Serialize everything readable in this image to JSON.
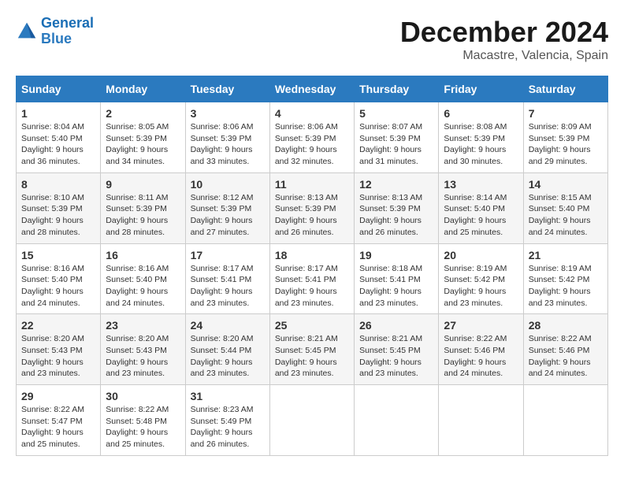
{
  "logo": {
    "line1": "General",
    "line2": "Blue"
  },
  "title": "December 2024",
  "location": "Macastre, Valencia, Spain",
  "days_of_week": [
    "Sunday",
    "Monday",
    "Tuesday",
    "Wednesday",
    "Thursday",
    "Friday",
    "Saturday"
  ],
  "weeks": [
    [
      {
        "day": "1",
        "sunrise": "8:04 AM",
        "sunset": "5:40 PM",
        "daylight": "9 hours and 36 minutes."
      },
      {
        "day": "2",
        "sunrise": "8:05 AM",
        "sunset": "5:39 PM",
        "daylight": "9 hours and 34 minutes."
      },
      {
        "day": "3",
        "sunrise": "8:06 AM",
        "sunset": "5:39 PM",
        "daylight": "9 hours and 33 minutes."
      },
      {
        "day": "4",
        "sunrise": "8:06 AM",
        "sunset": "5:39 PM",
        "daylight": "9 hours and 32 minutes."
      },
      {
        "day": "5",
        "sunrise": "8:07 AM",
        "sunset": "5:39 PM",
        "daylight": "9 hours and 31 minutes."
      },
      {
        "day": "6",
        "sunrise": "8:08 AM",
        "sunset": "5:39 PM",
        "daylight": "9 hours and 30 minutes."
      },
      {
        "day": "7",
        "sunrise": "8:09 AM",
        "sunset": "5:39 PM",
        "daylight": "9 hours and 29 minutes."
      }
    ],
    [
      {
        "day": "8",
        "sunrise": "8:10 AM",
        "sunset": "5:39 PM",
        "daylight": "9 hours and 28 minutes."
      },
      {
        "day": "9",
        "sunrise": "8:11 AM",
        "sunset": "5:39 PM",
        "daylight": "9 hours and 28 minutes."
      },
      {
        "day": "10",
        "sunrise": "8:12 AM",
        "sunset": "5:39 PM",
        "daylight": "9 hours and 27 minutes."
      },
      {
        "day": "11",
        "sunrise": "8:13 AM",
        "sunset": "5:39 PM",
        "daylight": "9 hours and 26 minutes."
      },
      {
        "day": "12",
        "sunrise": "8:13 AM",
        "sunset": "5:39 PM",
        "daylight": "9 hours and 26 minutes."
      },
      {
        "day": "13",
        "sunrise": "8:14 AM",
        "sunset": "5:40 PM",
        "daylight": "9 hours and 25 minutes."
      },
      {
        "day": "14",
        "sunrise": "8:15 AM",
        "sunset": "5:40 PM",
        "daylight": "9 hours and 24 minutes."
      }
    ],
    [
      {
        "day": "15",
        "sunrise": "8:16 AM",
        "sunset": "5:40 PM",
        "daylight": "9 hours and 24 minutes."
      },
      {
        "day": "16",
        "sunrise": "8:16 AM",
        "sunset": "5:40 PM",
        "daylight": "9 hours and 24 minutes."
      },
      {
        "day": "17",
        "sunrise": "8:17 AM",
        "sunset": "5:41 PM",
        "daylight": "9 hours and 23 minutes."
      },
      {
        "day": "18",
        "sunrise": "8:17 AM",
        "sunset": "5:41 PM",
        "daylight": "9 hours and 23 minutes."
      },
      {
        "day": "19",
        "sunrise": "8:18 AM",
        "sunset": "5:41 PM",
        "daylight": "9 hours and 23 minutes."
      },
      {
        "day": "20",
        "sunrise": "8:19 AM",
        "sunset": "5:42 PM",
        "daylight": "9 hours and 23 minutes."
      },
      {
        "day": "21",
        "sunrise": "8:19 AM",
        "sunset": "5:42 PM",
        "daylight": "9 hours and 23 minutes."
      }
    ],
    [
      {
        "day": "22",
        "sunrise": "8:20 AM",
        "sunset": "5:43 PM",
        "daylight": "9 hours and 23 minutes."
      },
      {
        "day": "23",
        "sunrise": "8:20 AM",
        "sunset": "5:43 PM",
        "daylight": "9 hours and 23 minutes."
      },
      {
        "day": "24",
        "sunrise": "8:20 AM",
        "sunset": "5:44 PM",
        "daylight": "9 hours and 23 minutes."
      },
      {
        "day": "25",
        "sunrise": "8:21 AM",
        "sunset": "5:45 PM",
        "daylight": "9 hours and 23 minutes."
      },
      {
        "day": "26",
        "sunrise": "8:21 AM",
        "sunset": "5:45 PM",
        "daylight": "9 hours and 23 minutes."
      },
      {
        "day": "27",
        "sunrise": "8:22 AM",
        "sunset": "5:46 PM",
        "daylight": "9 hours and 24 minutes."
      },
      {
        "day": "28",
        "sunrise": "8:22 AM",
        "sunset": "5:46 PM",
        "daylight": "9 hours and 24 minutes."
      }
    ],
    [
      {
        "day": "29",
        "sunrise": "8:22 AM",
        "sunset": "5:47 PM",
        "daylight": "9 hours and 25 minutes."
      },
      {
        "day": "30",
        "sunrise": "8:22 AM",
        "sunset": "5:48 PM",
        "daylight": "9 hours and 25 minutes."
      },
      {
        "day": "31",
        "sunrise": "8:23 AM",
        "sunset": "5:49 PM",
        "daylight": "9 hours and 26 minutes."
      },
      null,
      null,
      null,
      null
    ]
  ]
}
